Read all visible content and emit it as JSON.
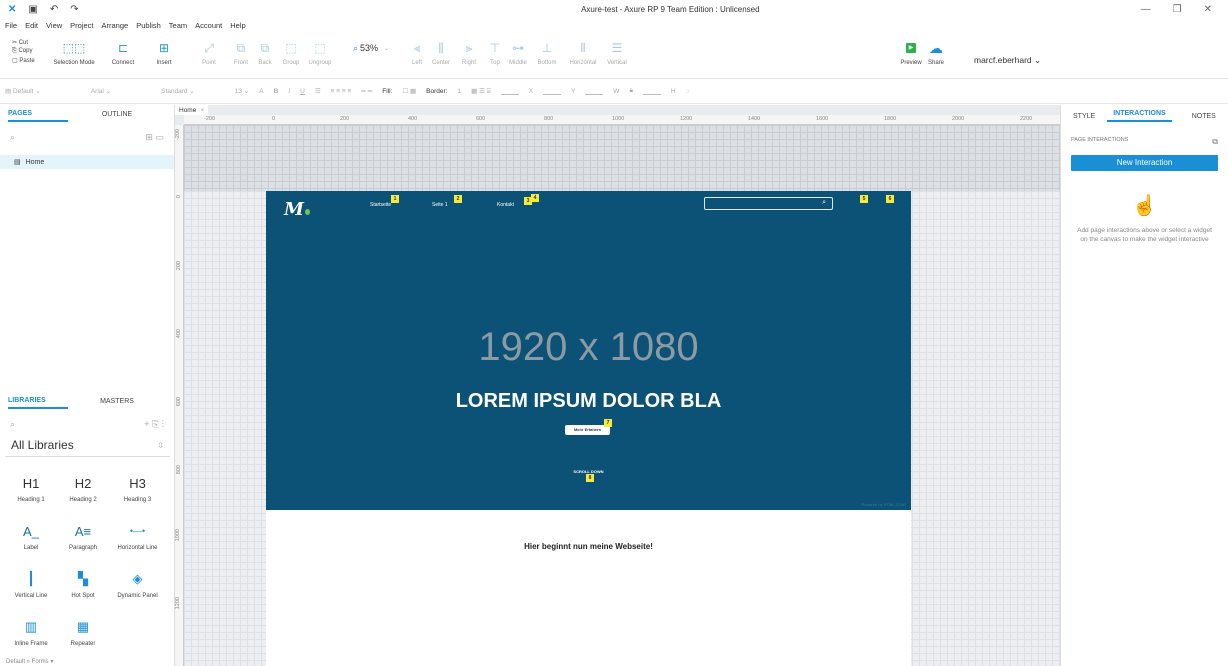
{
  "titlebar": {
    "title": "Axure-test - Axure RP 9 Team Edition : Unlicensed",
    "minimize_glyph": "—",
    "restore_glyph": "❐",
    "close_glyph": "✕"
  },
  "menu": [
    "File",
    "Edit",
    "View",
    "Project",
    "Arrange",
    "Publish",
    "Team",
    "Account",
    "Help"
  ],
  "clipboard": {
    "cut": "Cut",
    "copy": "Copy",
    "paste": "Paste"
  },
  "toolbar": {
    "selection_mode": "Selection Mode",
    "connect": "Connect",
    "insert": "Insert",
    "point": "Point",
    "front": "Front",
    "back": "Back",
    "group": "Group",
    "ungroup": "Ungroup",
    "zoom": "53%",
    "left": "Left",
    "center": "Center",
    "right": "Right",
    "top": "Top",
    "middle": "Middle",
    "bottom": "Bottom",
    "horizontal": "Horizontal",
    "vertical": "Vertical",
    "preview": "Preview",
    "share": "Share",
    "user": "marcf.eberhard"
  },
  "format": {
    "style": "Default",
    "font": "Arial",
    "weight": "Standard",
    "size": "13",
    "fill": "Fill:",
    "border": "Border:",
    "border_width": "1",
    "x": "X",
    "y": "Y",
    "w": "W",
    "h": "H"
  },
  "leftpanel": {
    "tabs": {
      "pages": "PAGES",
      "outline": "OUTLINE"
    },
    "page": "Home",
    "lib_tabs": {
      "libraries": "LIBRARIES",
      "masters": "MASTERS"
    },
    "lib_select": "All Libraries",
    "widgets": [
      {
        "glyph": "H1",
        "label": "Heading 1"
      },
      {
        "glyph": "H2",
        "label": "Heading 2"
      },
      {
        "glyph": "H3",
        "label": "Heading 3"
      },
      {
        "glyph": "A_",
        "label": "Label"
      },
      {
        "glyph": "A≡",
        "label": "Paragraph"
      },
      {
        "glyph": "•—•",
        "label": "Horizontal Line"
      },
      {
        "glyph": "┃",
        "label": "Vertical Line"
      },
      {
        "glyph": "▚",
        "label": "Hot Spot"
      },
      {
        "glyph": "◈",
        "label": "Dynamic Panel"
      },
      {
        "glyph": "▥",
        "label": "Inline Frame"
      },
      {
        "glyph": "▦",
        "label": "Repeater"
      }
    ],
    "footer": "Default » Forms ▾"
  },
  "canvas": {
    "tab": "Home",
    "ruler_h": [
      "-200",
      "0",
      "200",
      "400",
      "600",
      "800",
      "1000",
      "1200",
      "1400",
      "1600",
      "1800",
      "2000",
      "2200"
    ],
    "ruler_v": [
      "-200",
      "0",
      "200",
      "400",
      "600",
      "800",
      "1000",
      "1200"
    ],
    "mockup": {
      "logo": "M",
      "nav": [
        "Startseite",
        "Seite 1",
        "Kontakt"
      ],
      "size_placeholder": "1920 x 1080",
      "headline": "LOREM IPSUM DOLOR BLA",
      "button": "Mehr Erfahren",
      "scroll": "SCROLL DOWN",
      "credit": "Powered by HTML.COM",
      "body_text": "Hier beginnt nun meine Webseite!"
    }
  },
  "rightpanel": {
    "tabs": {
      "style": "STYLE",
      "interactions": "INTERACTIONS",
      "notes": "NOTES"
    },
    "section": "PAGE INTERACTIONS",
    "new_interaction": "New Interaction",
    "hint": "Add page interactions above or select a widget on the canvas to make the widget interactive"
  },
  "colors": {
    "accent": "#1a8fd6",
    "hero_bg": "#0b5276",
    "note": "#f4ea3a"
  }
}
